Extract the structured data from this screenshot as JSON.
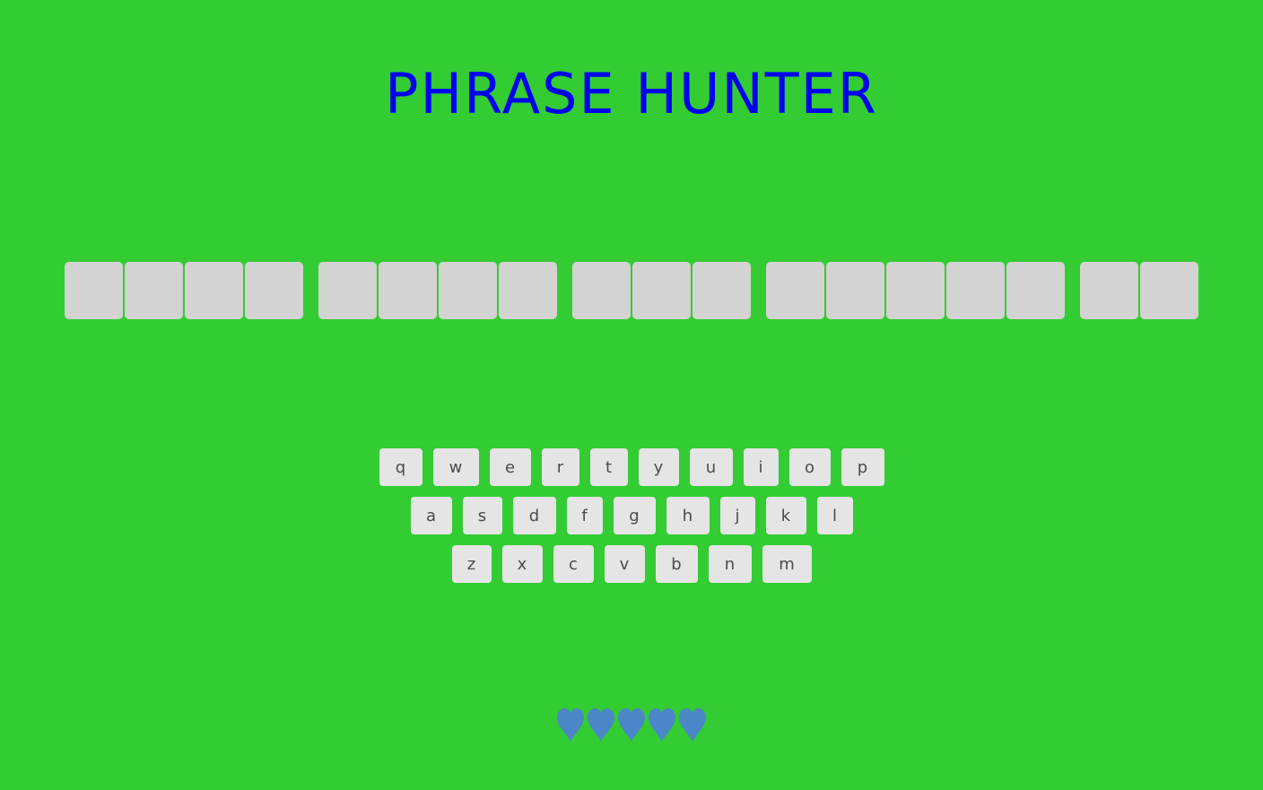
{
  "title": "PHRASE HUNTER",
  "phrase": {
    "word_lengths": [
      4,
      4,
      3,
      5,
      2
    ]
  },
  "keyboard": {
    "rows": [
      [
        "q",
        "w",
        "e",
        "r",
        "t",
        "y",
        "u",
        "i",
        "o",
        "p"
      ],
      [
        "a",
        "s",
        "d",
        "f",
        "g",
        "h",
        "j",
        "k",
        "l"
      ],
      [
        "z",
        "x",
        "c",
        "v",
        "b",
        "n",
        "m"
      ]
    ]
  },
  "lives": {
    "remaining": 5,
    "icon": "heart-icon"
  },
  "colors": {
    "background": "#33cc33",
    "title": "#0000ee",
    "tile": "#d3d3d3",
    "key": "#e5e5e5",
    "heart": "#4a86c8"
  }
}
